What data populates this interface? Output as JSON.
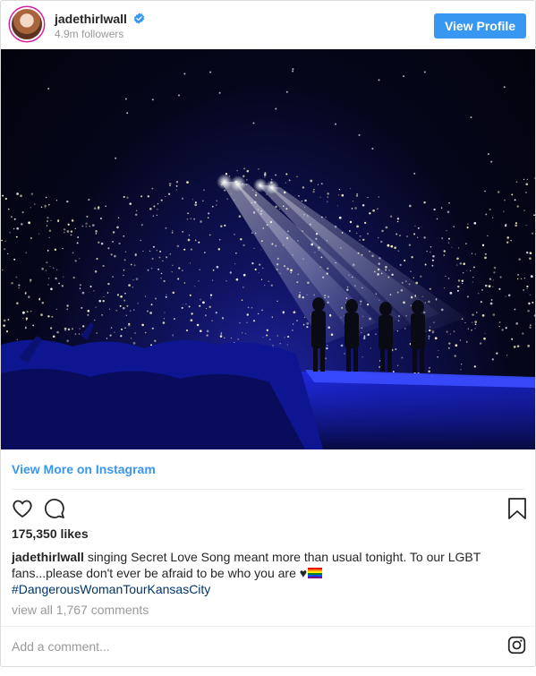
{
  "header": {
    "username": "jadethirlwall",
    "followers": "4.9m followers",
    "view_profile_label": "View Profile"
  },
  "post": {
    "view_more_label": "View More on Instagram",
    "likes": "175,350 likes",
    "caption": {
      "user": "jadethirlwall",
      "text": "singing Secret Love Song meant more than usual tonight. To our LGBT fans...please don't ever be afraid to be who you are ♥",
      "hashtag": "#DangerousWomanTourKansasCity"
    },
    "view_comments": "view all 1,767 comments",
    "add_comment_placeholder": "Add a comment..."
  },
  "icons": {
    "verified": "verified-badge-icon",
    "like": "heart-icon",
    "comment": "comment-icon",
    "save": "bookmark-icon",
    "instagram": "instagram-icon",
    "pride_flag": "rainbow-flag-icon"
  },
  "colors": {
    "link_blue": "#3897f0",
    "hashtag": "#003569",
    "muted": "#999999",
    "text": "#262626",
    "border": "#dbdbdb"
  }
}
